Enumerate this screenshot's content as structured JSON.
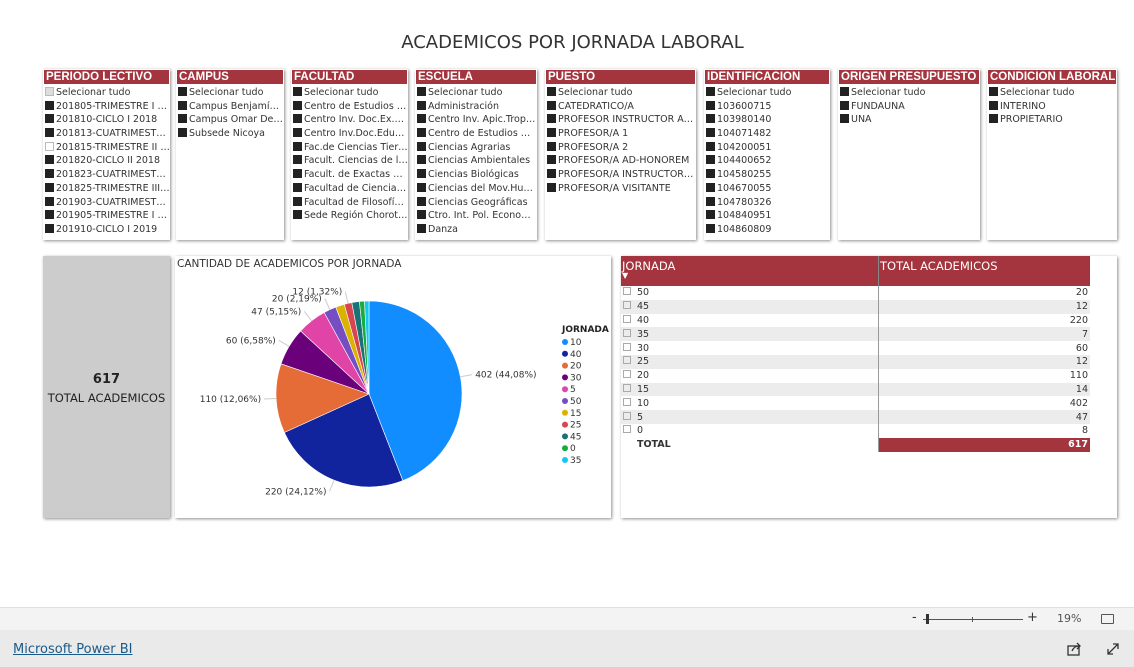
{
  "title": "ACADEMICOS POR JORNADA LABORAL",
  "slicers": [
    {
      "header": "PERIODO LECTIVO",
      "items": [
        {
          "label": "Selecionar tudo",
          "state": "partial"
        },
        {
          "label": "201805-TRIMESTRE I 2…",
          "state": "on"
        },
        {
          "label": "201810-CICLO I 2018",
          "state": "on"
        },
        {
          "label": "201813-CUATRIMESTR…",
          "state": "on"
        },
        {
          "label": "201815-TRIMESTRE II 2…",
          "state": "off"
        },
        {
          "label": "201820-CICLO II 2018",
          "state": "on"
        },
        {
          "label": "201823-CUATRIMESTR…",
          "state": "on"
        },
        {
          "label": "201825-TRIMESTRE III …",
          "state": "on"
        },
        {
          "label": "201903-CUATRIMESTR…",
          "state": "on"
        },
        {
          "label": "201905-TRIMESTRE I 2…",
          "state": "on"
        },
        {
          "label": "201910-CICLO I 2019",
          "state": "on"
        }
      ]
    },
    {
      "header": "CAMPUS",
      "items": [
        {
          "label": "Selecionar tudo",
          "state": "on"
        },
        {
          "label": "Campus Benjamín …",
          "state": "on"
        },
        {
          "label": "Campus Omar Den…",
          "state": "on"
        },
        {
          "label": "Subsede Nicoya",
          "state": "on"
        }
      ]
    },
    {
      "header": "FACULTAD",
      "items": [
        {
          "label": "Selecionar tudo",
          "state": "on"
        },
        {
          "label": "Centro de Estudios G…",
          "state": "on"
        },
        {
          "label": "Centro Inv. Doc.Ex.Ar…",
          "state": "on"
        },
        {
          "label": "Centro Inv.Doc.Educ.…",
          "state": "on"
        },
        {
          "label": "Fac.de Ciencias Tierra…",
          "state": "on"
        },
        {
          "label": "Facult. Ciencias de la …",
          "state": "on"
        },
        {
          "label": "Facult. de Exactas y N…",
          "state": "on"
        },
        {
          "label": "Facultad de Ciencias …",
          "state": "on"
        },
        {
          "label": "Facultad de Filosofía …",
          "state": "on"
        },
        {
          "label": "Sede Región Chorote…",
          "state": "on"
        }
      ]
    },
    {
      "header": "ESCUELA",
      "items": [
        {
          "label": "Selecionar tudo",
          "state": "on"
        },
        {
          "label": "Administración",
          "state": "on"
        },
        {
          "label": "Centro Inv. Apic.Trop.-…",
          "state": "on"
        },
        {
          "label": "Centro de Estudios Ge…",
          "state": "on"
        },
        {
          "label": "Ciencias Agrarias",
          "state": "on"
        },
        {
          "label": "Ciencias Ambientales",
          "state": "on"
        },
        {
          "label": "Ciencias Biológicas",
          "state": "on"
        },
        {
          "label": "Ciencias del Mov.Hum…",
          "state": "on"
        },
        {
          "label": "Ciencias Geográficas",
          "state": "on"
        },
        {
          "label": "Ctro. Int. Pol. Econom.…",
          "state": "on"
        },
        {
          "label": "Danza",
          "state": "on"
        }
      ]
    },
    {
      "header": "PUESTO",
      "items": [
        {
          "label": "Selecionar tudo",
          "state": "on"
        },
        {
          "label": "CATEDRATICO/A",
          "state": "on"
        },
        {
          "label": "PROFESOR INSTRUCTOR AC…",
          "state": "on"
        },
        {
          "label": "PROFESOR/A 1",
          "state": "on"
        },
        {
          "label": "PROFESOR/A 2",
          "state": "on"
        },
        {
          "label": "PROFESOR/A AD-HONOREM",
          "state": "on"
        },
        {
          "label": "PROFESOR/A INSTRUCTOR/A…",
          "state": "on"
        },
        {
          "label": "PROFESOR/A VISITANTE",
          "state": "on"
        }
      ]
    },
    {
      "header": "IDENTIFICACION",
      "items": [
        {
          "label": "Selecionar tudo",
          "state": "on"
        },
        {
          "label": "103600715",
          "state": "on"
        },
        {
          "label": "103980140",
          "state": "on"
        },
        {
          "label": "104071482",
          "state": "on"
        },
        {
          "label": "104200051",
          "state": "on"
        },
        {
          "label": "104400652",
          "state": "on"
        },
        {
          "label": "104580255",
          "state": "on"
        },
        {
          "label": "104670055",
          "state": "on"
        },
        {
          "label": "104780326",
          "state": "on"
        },
        {
          "label": "104840951",
          "state": "on"
        },
        {
          "label": "104860809",
          "state": "on"
        }
      ]
    },
    {
      "header": "ORIGEN PRESUPUESTO",
      "items": [
        {
          "label": "Selecionar tudo",
          "state": "on"
        },
        {
          "label": "FUNDAUNA",
          "state": "on"
        },
        {
          "label": "UNA",
          "state": "on"
        }
      ]
    },
    {
      "header": "CONDICION LABORAL",
      "items": [
        {
          "label": "Selecionar tudo",
          "state": "on"
        },
        {
          "label": "INTERINO",
          "state": "on"
        },
        {
          "label": "PROPIETARIO",
          "state": "on"
        }
      ]
    }
  ],
  "kpi": {
    "value": "617",
    "label": "TOTAL ACADEMICOS"
  },
  "chart_data": {
    "type": "pie",
    "title": "CANTIDAD DE ACADEMICOS POR JORNADA",
    "legend_title": "JORNADA",
    "legend_position": "right",
    "categories": [
      "10",
      "40",
      "20",
      "30",
      "5",
      "50",
      "15",
      "25",
      "45",
      "0",
      "35"
    ],
    "values": [
      402,
      220,
      110,
      60,
      47,
      20,
      14,
      12,
      12,
      8,
      7
    ],
    "colors": [
      "#118dff",
      "#12239e",
      "#e66c37",
      "#6b007b",
      "#e044a7",
      "#744ec2",
      "#d9b300",
      "#d64550",
      "#197278",
      "#1aab40",
      "#15c6f4"
    ],
    "data_labels": [
      "402 (44,08%)",
      "220 (24,12%)",
      "110 (12,06%)",
      "60 (6,58%)",
      "47 (5,15%)",
      "20 (2,19%)",
      "",
      "12 (1,32%)",
      "",
      "",
      ""
    ]
  },
  "table": {
    "headers": [
      "JORNADA",
      "TOTAL ACADEMICOS"
    ],
    "rows": [
      [
        "50",
        "20"
      ],
      [
        "45",
        "12"
      ],
      [
        "40",
        "220"
      ],
      [
        "35",
        "7"
      ],
      [
        "30",
        "60"
      ],
      [
        "25",
        "12"
      ],
      [
        "20",
        "110"
      ],
      [
        "15",
        "14"
      ],
      [
        "10",
        "402"
      ],
      [
        "5",
        "47"
      ],
      [
        "0",
        "8"
      ]
    ],
    "total_label": "TOTAL",
    "total_value": "617",
    "accent": "#a4343e"
  },
  "zoom": {
    "minus": "-",
    "plus": "+",
    "level": "19%",
    "percent": 19
  },
  "footer": {
    "brand": "Microsoft Power BI"
  }
}
